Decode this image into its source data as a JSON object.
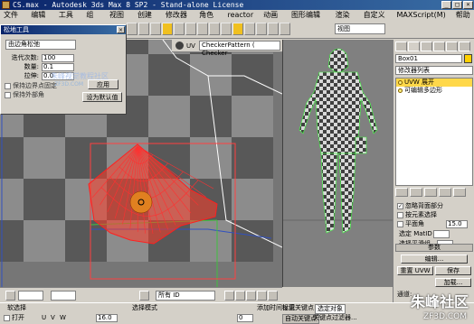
{
  "window": {
    "title": "CS.max  - Autodesk 3ds Max 8 SP2  - Stand-alone License",
    "min": "_",
    "max": "□",
    "close": "×"
  },
  "menu": [
    "文件(F)",
    "编辑(E)",
    "工具(T)",
    "组(G)",
    "视图(V)",
    "创建(C)",
    "修改器(O)",
    "角色(H)",
    "reactor",
    "动画(A)",
    "图形编辑器(D)",
    "渲染(R)",
    "自定义(U)",
    "MAXScript(M)",
    "帮助(H)"
  ],
  "toolbar": {
    "view_dropdown": "视图"
  },
  "uv_toolbar": {
    "uv_label": "UV",
    "checker": "CheckerPattern  ( Checker"
  },
  "float_window": {
    "title": "松地工具",
    "close": "×",
    "mode_dropdown": "由边角松弛",
    "rows": [
      {
        "label": "迭代次数:",
        "value": "100"
      },
      {
        "label": "数量:",
        "value": "0.1"
      },
      {
        "label": "拉伸:",
        "value": "0.0"
      }
    ],
    "checkbox_keep_boundary": "保持边界点固定",
    "checkbox_keep_outer_corner": "保持外部角",
    "apply_button": "应用",
    "default_button": "设为默认值"
  },
  "watermark": {
    "main": "朱峰视觉教程社区",
    "url": "ZF3D.COM"
  },
  "vp_bottom": {
    "all_id": "所有 ID",
    "field1": "",
    "field2": ""
  },
  "status": {
    "soft_select": "软选择",
    "select_mode": "选择模式",
    "open": "打开",
    "u": "U",
    "v": "V",
    "w": "W",
    "value": "16.0",
    "frame": "0",
    "add_time": "添加时间标记",
    "auto_key": "自动关键点",
    "set_key": "设置关键点",
    "selected": "选定对象",
    "key_filter": "关键点过滤器..."
  },
  "command_panel": {
    "object_name": "Box01",
    "modifier_list": "修改器列表",
    "stack": [
      {
        "label": "UVW 展开",
        "selected": true
      },
      {
        "label": "可编辑多边形",
        "selected": false
      }
    ],
    "selection_params": {
      "ignore_back": "忽略背面部分",
      "by_element": "按元素选择",
      "planar": "平面角",
      "planar_value": "15.0",
      "select_matid": "选定 MatID",
      "select_smooth": "选择平滑组"
    },
    "params_header": "参数",
    "edit_button": "编辑...",
    "reset_button": "重置 UVW",
    "save_button": "保存",
    "load_button": "加载...",
    "channel_label": "通道:"
  },
  "logo": {
    "main": "朱峰社区",
    "url": "ZF3D.COM"
  },
  "colors": {
    "title_start": "#0a246a",
    "title_end": "#3a6ea5",
    "selection_red": "#ff2020",
    "panel": "#d4d0c8"
  }
}
